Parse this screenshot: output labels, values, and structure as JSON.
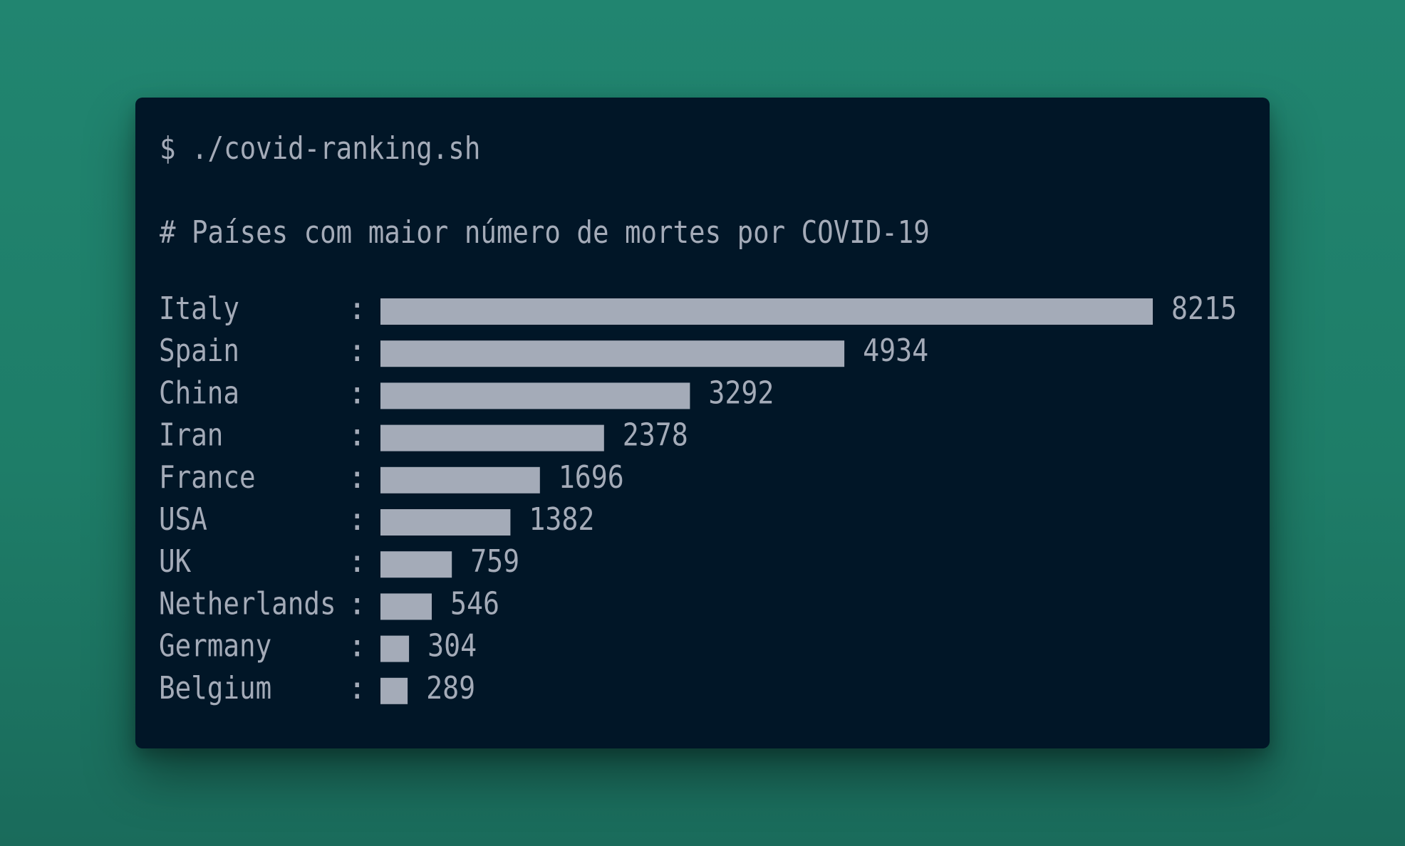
{
  "terminal": {
    "command": "$ ./covid-ranking.sh",
    "title": "# Países com maior número de mortes por COVID-19"
  },
  "colors": {
    "background": "#218570",
    "terminal": "#011627",
    "text": "#a4abb8",
    "bar": "#a4abb8"
  },
  "chart_data": {
    "type": "bar",
    "orientation": "horizontal",
    "title": "# Países com maior número de mortes por COVID-19",
    "categories": [
      "Italy",
      "Spain",
      "China",
      "Iran",
      "France",
      "USA",
      "UK",
      "Netherlands",
      "Germany",
      "Belgium"
    ],
    "values": [
      8215,
      4934,
      3292,
      2378,
      1696,
      1382,
      759,
      546,
      304,
      289
    ],
    "separator": ":",
    "grid": false,
    "legend": "none"
  }
}
